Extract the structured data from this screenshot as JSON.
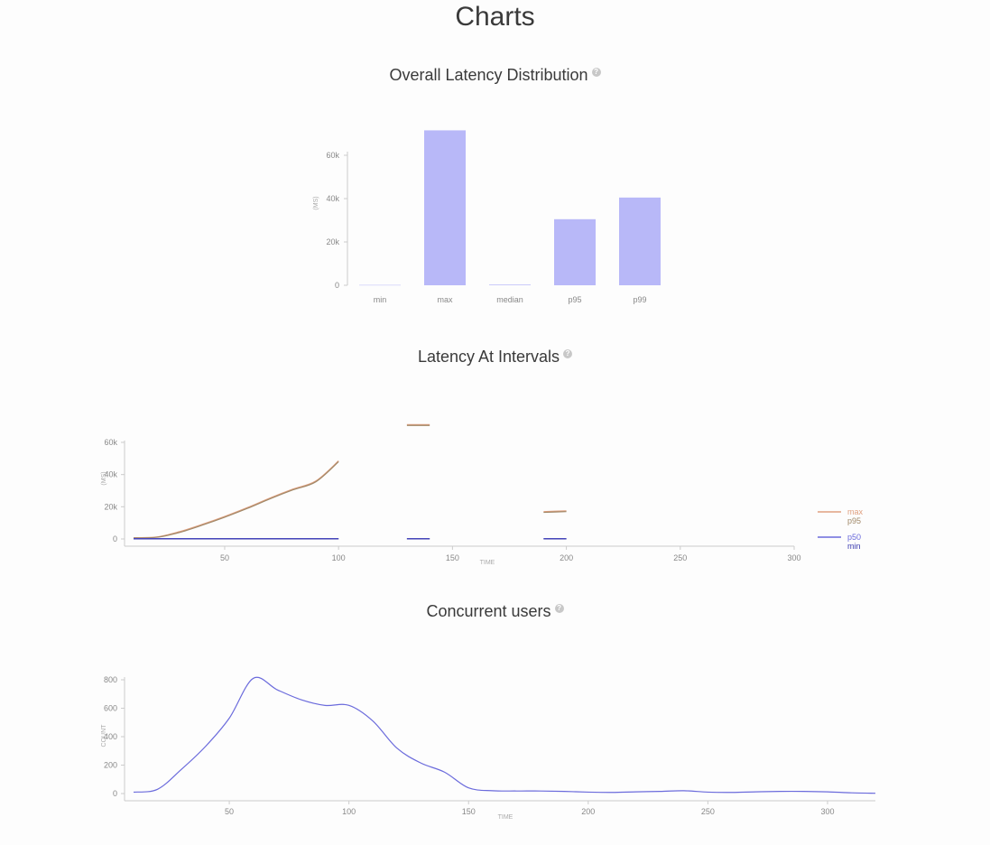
{
  "page": {
    "title": "Charts"
  },
  "sections": {
    "distribution": {
      "title": "Overall Latency Distribution",
      "help_icon": "question-circle-icon"
    },
    "intervals": {
      "title": "Latency At Intervals",
      "help_icon": "question-circle-icon"
    },
    "concurrent": {
      "title": "Concurrent users",
      "help_icon": "question-circle-icon"
    }
  },
  "colors": {
    "bar": "#b8b8f8",
    "p50": "#6b6bdc",
    "min": "#3b3bb0",
    "max": "#e0a080",
    "p95": "#a08868",
    "users": "#6b6bdc",
    "axis": "#cccccc",
    "tick_text": "#888888"
  },
  "chart_data": [
    {
      "type": "bar",
      "title": "Overall Latency Distribution",
      "ylabel": "(MS)",
      "categories": [
        "min",
        "max",
        "median",
        "p95",
        "p99"
      ],
      "values": [
        150,
        71500,
        300,
        30500,
        40500
      ],
      "ylim": [
        0,
        60000
      ],
      "yticks": [
        0,
        20000,
        40000,
        60000
      ],
      "ytick_labels": [
        "0",
        "20k",
        "40k",
        "60k"
      ]
    },
    {
      "type": "line",
      "title": "Latency At Intervals",
      "xlabel": "TIME",
      "ylabel": "(MS)",
      "xlim": [
        10,
        300
      ],
      "ylim": [
        0,
        60000
      ],
      "xticks": [
        50,
        100,
        150,
        200,
        250,
        300
      ],
      "yticks": [
        0,
        20000,
        40000,
        60000
      ],
      "ytick_labels": [
        "0",
        "20k",
        "40k",
        "60k"
      ],
      "legend": "right",
      "series": [
        {
          "name": "max",
          "segments": [
            [
              [
                10,
                800
              ],
              [
                20,
                1200
              ],
              [
                30,
                4500
              ],
              [
                40,
                9000
              ],
              [
                50,
                14000
              ],
              [
                60,
                19500
              ],
              [
                70,
                25500
              ],
              [
                80,
                31000
              ],
              [
                90,
                36000
              ],
              [
                100,
                48500
              ]
            ],
            [
              [
                130,
                71000
              ],
              [
                140,
                71000
              ]
            ],
            [
              [
                190,
                17000
              ],
              [
                200,
                17500
              ]
            ]
          ]
        },
        {
          "name": "p95",
          "segments": [
            [
              [
                10,
                600
              ],
              [
                20,
                1000
              ],
              [
                30,
                4000
              ],
              [
                40,
                8500
              ],
              [
                50,
                13500
              ],
              [
                60,
                19000
              ],
              [
                70,
                25000
              ],
              [
                80,
                30500
              ],
              [
                90,
                35500
              ],
              [
                100,
                48000
              ]
            ],
            [
              [
                130,
                70500
              ],
              [
                140,
                70500
              ]
            ],
            [
              [
                190,
                16500
              ],
              [
                200,
                17000
              ]
            ]
          ]
        },
        {
          "name": "p50",
          "segments": [
            [
              [
                10,
                200
              ],
              [
                100,
                200
              ]
            ],
            [
              [
                130,
                200
              ],
              [
                140,
                200
              ]
            ],
            [
              [
                190,
                200
              ],
              [
                200,
                200
              ]
            ]
          ]
        },
        {
          "name": "min",
          "segments": [
            [
              [
                10,
                50
              ],
              [
                100,
                50
              ]
            ],
            [
              [
                130,
                50
              ],
              [
                140,
                50
              ]
            ],
            [
              [
                190,
                50
              ],
              [
                200,
                50
              ]
            ]
          ]
        }
      ]
    },
    {
      "type": "line",
      "title": "Concurrent users",
      "xlabel": "TIME",
      "ylabel": "COUNT",
      "xlim": [
        10,
        320
      ],
      "ylim": [
        0,
        800
      ],
      "xticks": [
        50,
        100,
        150,
        200,
        250,
        300
      ],
      "yticks": [
        0,
        200,
        400,
        600,
        800
      ],
      "series": [
        {
          "name": "",
          "x": [
            10,
            20,
            30,
            40,
            50,
            60,
            70,
            80,
            90,
            100,
            110,
            120,
            130,
            140,
            150,
            160,
            170,
            180,
            190,
            200,
            210,
            220,
            230,
            240,
            250,
            260,
            270,
            280,
            290,
            300,
            310,
            320
          ],
          "y": [
            10,
            30,
            170,
            330,
            530,
            810,
            730,
            660,
            620,
            620,
            510,
            320,
            215,
            150,
            40,
            20,
            18,
            18,
            15,
            10,
            8,
            12,
            15,
            20,
            10,
            8,
            12,
            15,
            15,
            12,
            5,
            2
          ]
        }
      ]
    }
  ]
}
